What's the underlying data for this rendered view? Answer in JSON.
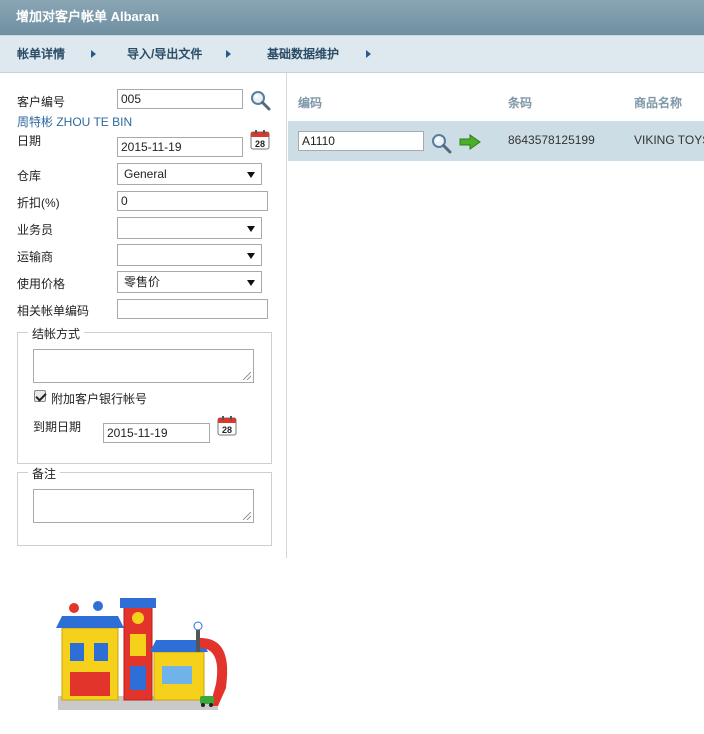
{
  "window": {
    "title": "增加对客户帐单 Albaran"
  },
  "menu": {
    "items": [
      {
        "label": "帐单详情"
      },
      {
        "label": "导入/导出文件"
      },
      {
        "label": "基础数据维护"
      }
    ]
  },
  "form": {
    "customer_code_label": "客户编号",
    "customer_code_value": "005",
    "customer_name_link": "周特彬 ZHOU TE BIN",
    "date_label": "日期",
    "date_value": "2015-11-19",
    "calendar_day": "28",
    "warehouse_label": "仓库",
    "warehouse_value": "General",
    "discount_label": "折扣(%)",
    "discount_value": "0",
    "salesperson_label": "业务员",
    "salesperson_value": "",
    "carrier_label": "运输商",
    "carrier_value": "",
    "price_label": "使用价格",
    "price_value": "零售价",
    "related_doc_label": "相关帐单编码",
    "related_doc_value": ""
  },
  "payment": {
    "legend": "结帐方式",
    "method_value": "",
    "attach_bank_label": "附加客户银行帐号",
    "attach_bank_checked": true,
    "due_date_label": "到期日期",
    "due_date_value": "2015-11-19"
  },
  "notes": {
    "legend": "备注",
    "value": ""
  },
  "table": {
    "columns": [
      "编码",
      "条码",
      "商品名称"
    ],
    "rows": [
      {
        "code": "A1110",
        "barcode": "8643578125199",
        "name": "VIKING TOYS"
      }
    ]
  }
}
